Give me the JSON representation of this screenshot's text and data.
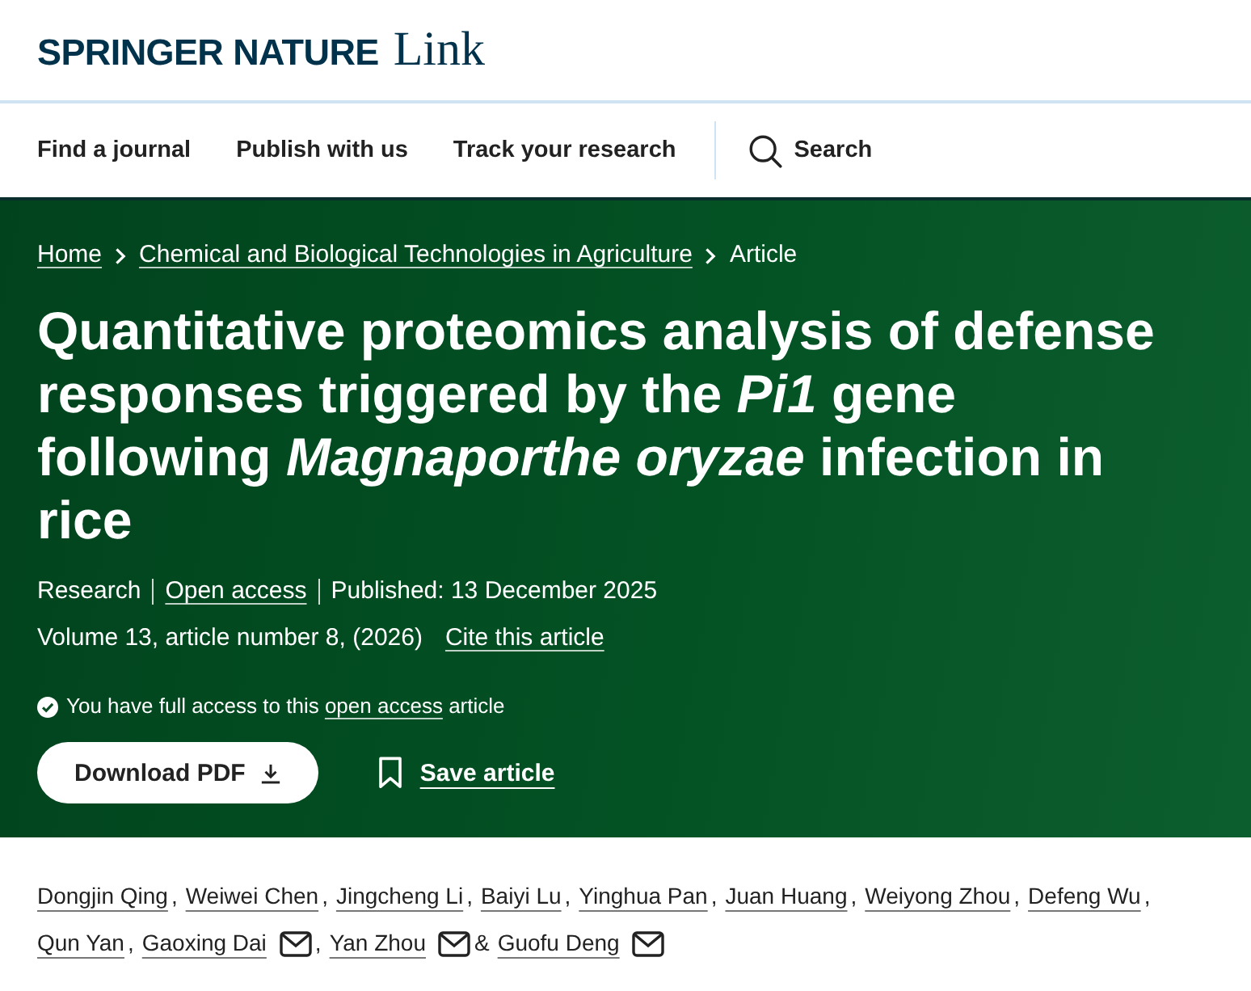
{
  "header": {
    "logo": {
      "brand": "SPRINGER NATURE",
      "product": "Link"
    },
    "nav": [
      "Find a journal",
      "Publish with us",
      "Track your research"
    ],
    "search": {
      "label": "Search"
    }
  },
  "hero": {
    "breadcrumb": [
      {
        "label": "Home",
        "link": true
      },
      {
        "label": "Chemical and Biological Technologies in Agriculture",
        "link": true
      },
      {
        "label": "Article",
        "link": false
      }
    ],
    "title": "Quantitative proteomics analysis of defense responses triggered by the *Pi1* gene following *Magnaporthe oryzae* infection in rice",
    "meta": [
      {
        "label": "Research",
        "link": false
      },
      {
        "label": "Open access",
        "link": true
      },
      {
        "label": "Published: 13 December 2025",
        "link": false
      }
    ],
    "citation": "Volume 13, article number 8, (2026)",
    "cite_link": "Cite this article",
    "access_notice": {
      "before": "You have full access to this",
      "link": "open access",
      "after": "article"
    },
    "download_button": "Download PDF",
    "save_button": "Save article"
  },
  "authors": [
    {
      "name": "Dongjin Qing",
      "corresponding": false,
      "separator": ","
    },
    {
      "name": "Weiwei Chen",
      "corresponding": false,
      "separator": ","
    },
    {
      "name": "Jingcheng Li",
      "corresponding": false,
      "separator": ","
    },
    {
      "name": "Baiyi Lu",
      "corresponding": false,
      "separator": ","
    },
    {
      "name": "Yinghua Pan",
      "corresponding": false,
      "separator": ","
    },
    {
      "name": "Juan Huang",
      "corresponding": false,
      "separator": ","
    },
    {
      "name": "Weiyong Zhou",
      "corresponding": false,
      "separator": ","
    },
    {
      "name": "Defeng Wu",
      "corresponding": false,
      "separator": ","
    },
    {
      "name": "Qun Yan",
      "corresponding": false,
      "separator": ","
    },
    {
      "name": "Gaoxing Dai",
      "corresponding": true,
      "separator": ","
    },
    {
      "name": "Yan Zhou",
      "corresponding": true,
      "separator": "&"
    },
    {
      "name": "Guofu Deng",
      "corresponding": true
    }
  ]
}
